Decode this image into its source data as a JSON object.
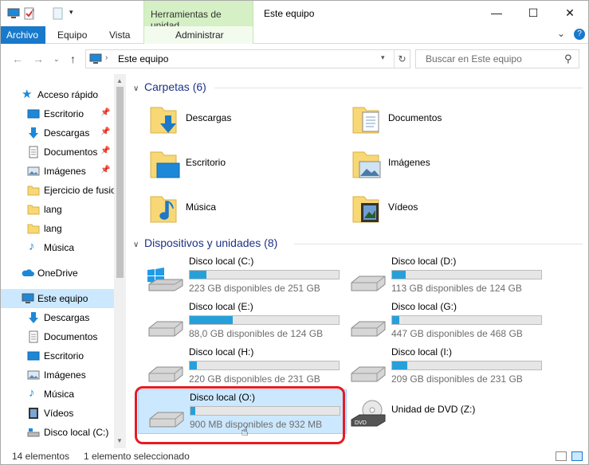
{
  "window": {
    "title": "Este equipo",
    "contextual_tab": "Herramientas de unidad",
    "controls": {
      "minimize": "—",
      "maximize": "☐",
      "close": "✕"
    }
  },
  "ribbon": {
    "tabs": [
      "Archivo",
      "Equipo",
      "Vista",
      "Administrar"
    ],
    "expand_icon": "⌄",
    "help_icon": "?"
  },
  "address": {
    "path": "Este equipo",
    "search_placeholder": "Buscar en Este equipo"
  },
  "sidebar": {
    "quick_access": "Acceso rápido",
    "quick_items": [
      "Escritorio",
      "Descargas",
      "Documentos",
      "Imágenes",
      "Ejercicio de fusio",
      "lang",
      "lang",
      "Música"
    ],
    "onedrive": "OneDrive",
    "this_pc": "Este equipo",
    "pc_items": [
      "Descargas",
      "Documentos",
      "Escritorio",
      "Imágenes",
      "Música",
      "Vídeos",
      "Disco local (C:)"
    ]
  },
  "folders_group": {
    "title": "Carpetas (6)",
    "items": [
      "Descargas",
      "Documentos",
      "Escritorio",
      "Imágenes",
      "Música",
      "Vídeos"
    ]
  },
  "drives_group": {
    "title": "Dispositivos y unidades (8)",
    "drives": [
      {
        "name": "Disco local (C:)",
        "free": "223 GB disponibles de 251 GB",
        "used_fraction": 0.11
      },
      {
        "name": "Disco local (D:)",
        "free": "113 GB disponibles de 124 GB",
        "used_fraction": 0.09
      },
      {
        "name": "Disco local (E:)",
        "free": "88,0 GB disponibles de 124 GB",
        "used_fraction": 0.29
      },
      {
        "name": "Disco local (G:)",
        "free": "447 GB disponibles de 468 GB",
        "used_fraction": 0.05
      },
      {
        "name": "Disco local (H:)",
        "free": "220 GB disponibles de 231 GB",
        "used_fraction": 0.05
      },
      {
        "name": "Disco local (I:)",
        "free": "209 GB disponibles de 231 GB",
        "used_fraction": 0.1
      },
      {
        "name": "Disco local (O:)",
        "free": "900 MB disponibles de 932 MB",
        "used_fraction": 0.03
      },
      {
        "name": "Unidad de DVD (Z:)"
      }
    ]
  },
  "status": {
    "count": "14 elementos",
    "selection": "1 elemento seleccionado"
  },
  "colors": {
    "accent": "#1979ca",
    "selection": "#cce8ff",
    "bar": "#26a0da",
    "highlight": "#e51c23"
  }
}
